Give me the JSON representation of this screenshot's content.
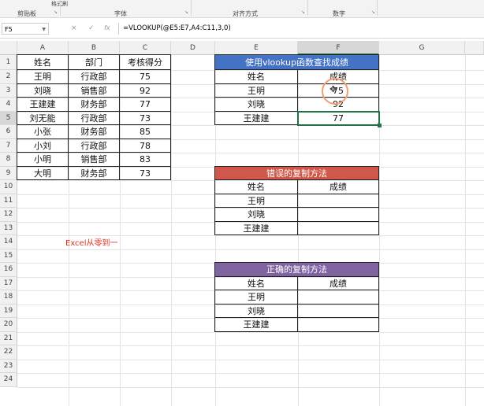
{
  "ribbon": {
    "groups": [
      "剪贴板",
      "字体",
      "对齐方式",
      "数字"
    ],
    "format_painter": "格式刷"
  },
  "formula_bar": {
    "name_box": "F5",
    "formula": "=VLOOKUP(@E5:E7,A4:C11,3,0)",
    "cancel": "×",
    "enter": "✓",
    "fx": "fx"
  },
  "columns": [
    "A",
    "B",
    "C",
    "D",
    "E",
    "F",
    "G"
  ],
  "selected_cell": "F5",
  "rows": [
    "1",
    "2",
    "3",
    "4",
    "5",
    "6",
    "7",
    "8",
    "9",
    "10",
    "11",
    "12",
    "13",
    "14",
    "15",
    "16",
    "17",
    "18",
    "19",
    "20",
    "21",
    "22",
    "23",
    "24"
  ],
  "source_table": {
    "headers": [
      "姓名",
      "部门",
      "考核得分"
    ],
    "rows": [
      [
        "王明",
        "行政部",
        "75"
      ],
      [
        "刘晓",
        "销售部",
        "92"
      ],
      [
        "王建建",
        "财务部",
        "77"
      ],
      [
        "刘无能",
        "行政部",
        "73"
      ],
      [
        "小张",
        "财务部",
        "85"
      ],
      [
        "小刘",
        "行政部",
        "78"
      ],
      [
        "小明",
        "销售部",
        "83"
      ],
      [
        "大明",
        "财务部",
        "73"
      ]
    ]
  },
  "lookup_table": {
    "title": "使用vlookup函数查找成绩",
    "color": "#4472c4",
    "headers": [
      "姓名",
      "成绩"
    ],
    "rows": [
      [
        "王明",
        "75"
      ],
      [
        "刘晓",
        "92"
      ],
      [
        "王建建",
        "77"
      ]
    ]
  },
  "wrong_table": {
    "title": "错误的复制方法",
    "color": "#d0574b",
    "headers": [
      "姓名",
      "成绩"
    ],
    "rows": [
      [
        "王明",
        ""
      ],
      [
        "刘晓",
        ""
      ],
      [
        "王建建",
        ""
      ]
    ]
  },
  "right_table": {
    "title": "正确的复制方法",
    "color": "#8064a2",
    "headers": [
      "姓名",
      "成绩"
    ],
    "rows": [
      [
        "王明",
        ""
      ],
      [
        "刘晓",
        ""
      ],
      [
        "王建建",
        ""
      ]
    ]
  },
  "watermark": "Excel从零到一"
}
